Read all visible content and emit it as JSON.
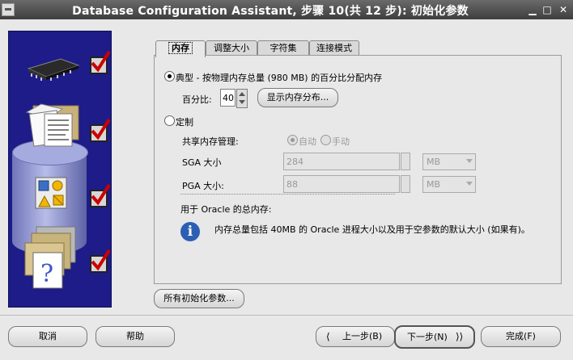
{
  "window": {
    "title": "Database Configuration Assistant, 步骤 10(共 12 步): 初始化参数"
  },
  "tabs": [
    {
      "label": "内存",
      "active": true
    },
    {
      "label": "调整大小",
      "active": false
    },
    {
      "label": "字符集",
      "active": false
    },
    {
      "label": "连接模式",
      "active": false
    }
  ],
  "memory": {
    "typical_label": "典型 - 按物理内存总量 (980 MB) 的百分比分配内存",
    "typical_selected": true,
    "percent_label": "百分比:",
    "percent_value": "40",
    "show_distribution_button": "显示内存分布...",
    "custom_label": "定制",
    "custom_selected": false,
    "shared_mem_label": "共享内存管理:",
    "auto_label": "自动",
    "manual_label": "手动",
    "sga_label": "SGA 大小",
    "sga_value": "284",
    "sga_unit": "MB",
    "pga_label": "PGA 大小:",
    "pga_value": "88",
    "pga_unit": "MB",
    "total_label": "用于 Oracle 的总内存:",
    "info_text": "内存总量包括 40MB 的 Oracle 进程大小以及用于空参数的默认大小 (如果有)。"
  },
  "all_params_button": "所有初始化参数...",
  "footer": {
    "cancel": "取消",
    "help": "帮助",
    "back": "上一步(B)",
    "next": "下一步(N)",
    "finish": "完成(F)"
  },
  "icons": [
    "chip-icon",
    "documents-folder-icon",
    "shapes-icon",
    "help-folder-icon",
    "checkmark-icon",
    "info-icon"
  ],
  "colors": {
    "side_panel": "#1d1c88",
    "titlebar": "#4a4a4a",
    "check": "#cc0000"
  }
}
